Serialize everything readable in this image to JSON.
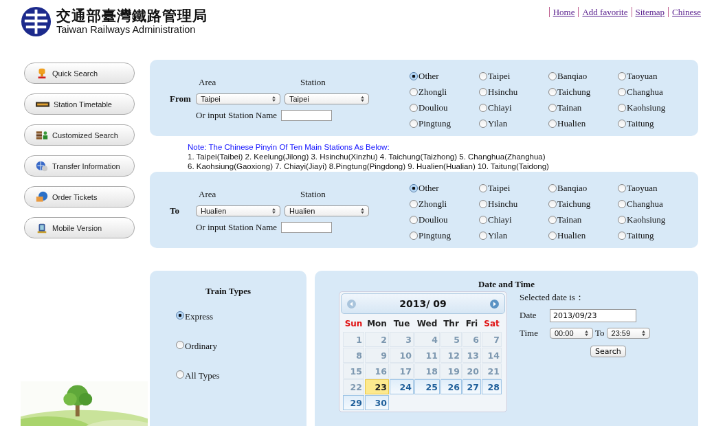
{
  "header": {
    "title_zh": "交通部臺灣鐵路管理局",
    "title_en": "Taiwan Railways Administration",
    "links": [
      "Home",
      "Add favorite",
      "Sitemap",
      "Chinese"
    ]
  },
  "sidebar": {
    "items": [
      {
        "label": "Quick Search"
      },
      {
        "label": "Station Timetable"
      },
      {
        "label": "Customized Search"
      },
      {
        "label": "Transfer Information"
      },
      {
        "label": "Order Tickets"
      },
      {
        "label": "Mobile Version"
      }
    ]
  },
  "from": {
    "label": "From",
    "area_label": "Area",
    "station_label": "Station",
    "area": "Taipei",
    "station": "Taipei",
    "input_label": "Or input Station Name",
    "stations": [
      {
        "label": "Other",
        "selected": true
      },
      {
        "label": "Taipei",
        "selected": false
      },
      {
        "label": "Banqiao",
        "selected": false
      },
      {
        "label": "Taoyuan",
        "selected": false
      },
      {
        "label": "Zhongli",
        "selected": false
      },
      {
        "label": "Hsinchu",
        "selected": false
      },
      {
        "label": "Taichung",
        "selected": false
      },
      {
        "label": "Changhua",
        "selected": false
      },
      {
        "label": "Douliou",
        "selected": false
      },
      {
        "label": "Chiayi",
        "selected": false
      },
      {
        "label": "Tainan",
        "selected": false
      },
      {
        "label": "Kaohsiung",
        "selected": false
      },
      {
        "label": "Pingtung",
        "selected": false
      },
      {
        "label": "Yilan",
        "selected": false
      },
      {
        "label": "Hualien",
        "selected": false
      },
      {
        "label": "Taitung",
        "selected": false
      }
    ]
  },
  "note": {
    "title": "Note: The Chinese Pinyin Of Ten Main Stations As Below:",
    "lines": [
      "1. Taipei(Taibei) 2. Keelung(Jilong) 3. Hsinchu(Xinzhu) 4. Taichung(Taizhong) 5. Changhua(Zhanghua)",
      "6. Kaohsiung(Gaoxiong) 7. Chiayi(Jiayi) 8.Pingtung(Pingdong) 9. Hualien(Hualian) 10. Taitung(Taidong)"
    ]
  },
  "to": {
    "label": "To",
    "area_label": "Area",
    "station_label": "Station",
    "area": "Hualien",
    "station": "Hualien",
    "input_label": "Or input Station Name",
    "stations": [
      {
        "label": "Other",
        "selected": true
      },
      {
        "label": "Taipei",
        "selected": false
      },
      {
        "label": "Banqiao",
        "selected": false
      },
      {
        "label": "Taoyuan",
        "selected": false
      },
      {
        "label": "Zhongli",
        "selected": false
      },
      {
        "label": "Hsinchu",
        "selected": false
      },
      {
        "label": "Taichung",
        "selected": false
      },
      {
        "label": "Changhua",
        "selected": false
      },
      {
        "label": "Douliou",
        "selected": false
      },
      {
        "label": "Chiayi",
        "selected": false
      },
      {
        "label": "Tainan",
        "selected": false
      },
      {
        "label": "Kaohsiung",
        "selected": false
      },
      {
        "label": "Pingtung",
        "selected": false
      },
      {
        "label": "Yilan",
        "selected": false
      },
      {
        "label": "Hualien",
        "selected": false
      },
      {
        "label": "Taitung",
        "selected": false
      }
    ]
  },
  "train_types": {
    "title": "Train Types",
    "options": [
      {
        "label": "Express",
        "selected": true
      },
      {
        "label": "Ordinary",
        "selected": false
      },
      {
        "label": "All Types",
        "selected": false
      }
    ]
  },
  "date_time": {
    "title": "Date and Time",
    "calendar": {
      "month": "2013/ 09",
      "weekdays": [
        {
          "label": "Sun",
          "weekend": true
        },
        {
          "label": "Mon",
          "weekend": false
        },
        {
          "label": "Tue",
          "weekend": false
        },
        {
          "label": "Wed",
          "weekend": false
        },
        {
          "label": "Thr",
          "weekend": false
        },
        {
          "label": "Fri",
          "weekend": false
        },
        {
          "label": "Sat",
          "weekend": true
        }
      ],
      "days": [
        {
          "label": "1",
          "disabled": true,
          "selected": false
        },
        {
          "label": "2",
          "disabled": true,
          "selected": false
        },
        {
          "label": "3",
          "disabled": true,
          "selected": false
        },
        {
          "label": "4",
          "disabled": true,
          "selected": false
        },
        {
          "label": "5",
          "disabled": true,
          "selected": false
        },
        {
          "label": "6",
          "disabled": true,
          "selected": false
        },
        {
          "label": "7",
          "disabled": true,
          "selected": false
        },
        {
          "label": "8",
          "disabled": true,
          "selected": false
        },
        {
          "label": "9",
          "disabled": true,
          "selected": false
        },
        {
          "label": "10",
          "disabled": true,
          "selected": false
        },
        {
          "label": "11",
          "disabled": true,
          "selected": false
        },
        {
          "label": "12",
          "disabled": true,
          "selected": false
        },
        {
          "label": "13",
          "disabled": true,
          "selected": false
        },
        {
          "label": "14",
          "disabled": true,
          "selected": false
        },
        {
          "label": "15",
          "disabled": true,
          "selected": false
        },
        {
          "label": "16",
          "disabled": true,
          "selected": false
        },
        {
          "label": "17",
          "disabled": true,
          "selected": false
        },
        {
          "label": "18",
          "disabled": true,
          "selected": false
        },
        {
          "label": "19",
          "disabled": true,
          "selected": false
        },
        {
          "label": "20",
          "disabled": true,
          "selected": false
        },
        {
          "label": "21",
          "disabled": true,
          "selected": false
        },
        {
          "label": "22",
          "disabled": true,
          "selected": false
        },
        {
          "label": "23",
          "disabled": false,
          "selected": true
        },
        {
          "label": "24",
          "disabled": false,
          "selected": false
        },
        {
          "label": "25",
          "disabled": false,
          "selected": false
        },
        {
          "label": "26",
          "disabled": false,
          "selected": false
        },
        {
          "label": "27",
          "disabled": false,
          "selected": false
        },
        {
          "label": "28",
          "disabled": false,
          "selected": false
        },
        {
          "label": "29",
          "disabled": false,
          "selected": false
        },
        {
          "label": "30",
          "disabled": false,
          "selected": false
        }
      ]
    },
    "selected_label": "Selected date is：",
    "date_label": "Date",
    "date_value": "2013/09/23",
    "time_label": "Time",
    "time_from": "00:00",
    "to_label": "To",
    "time_to": "23:59",
    "search_button": "Search"
  }
}
